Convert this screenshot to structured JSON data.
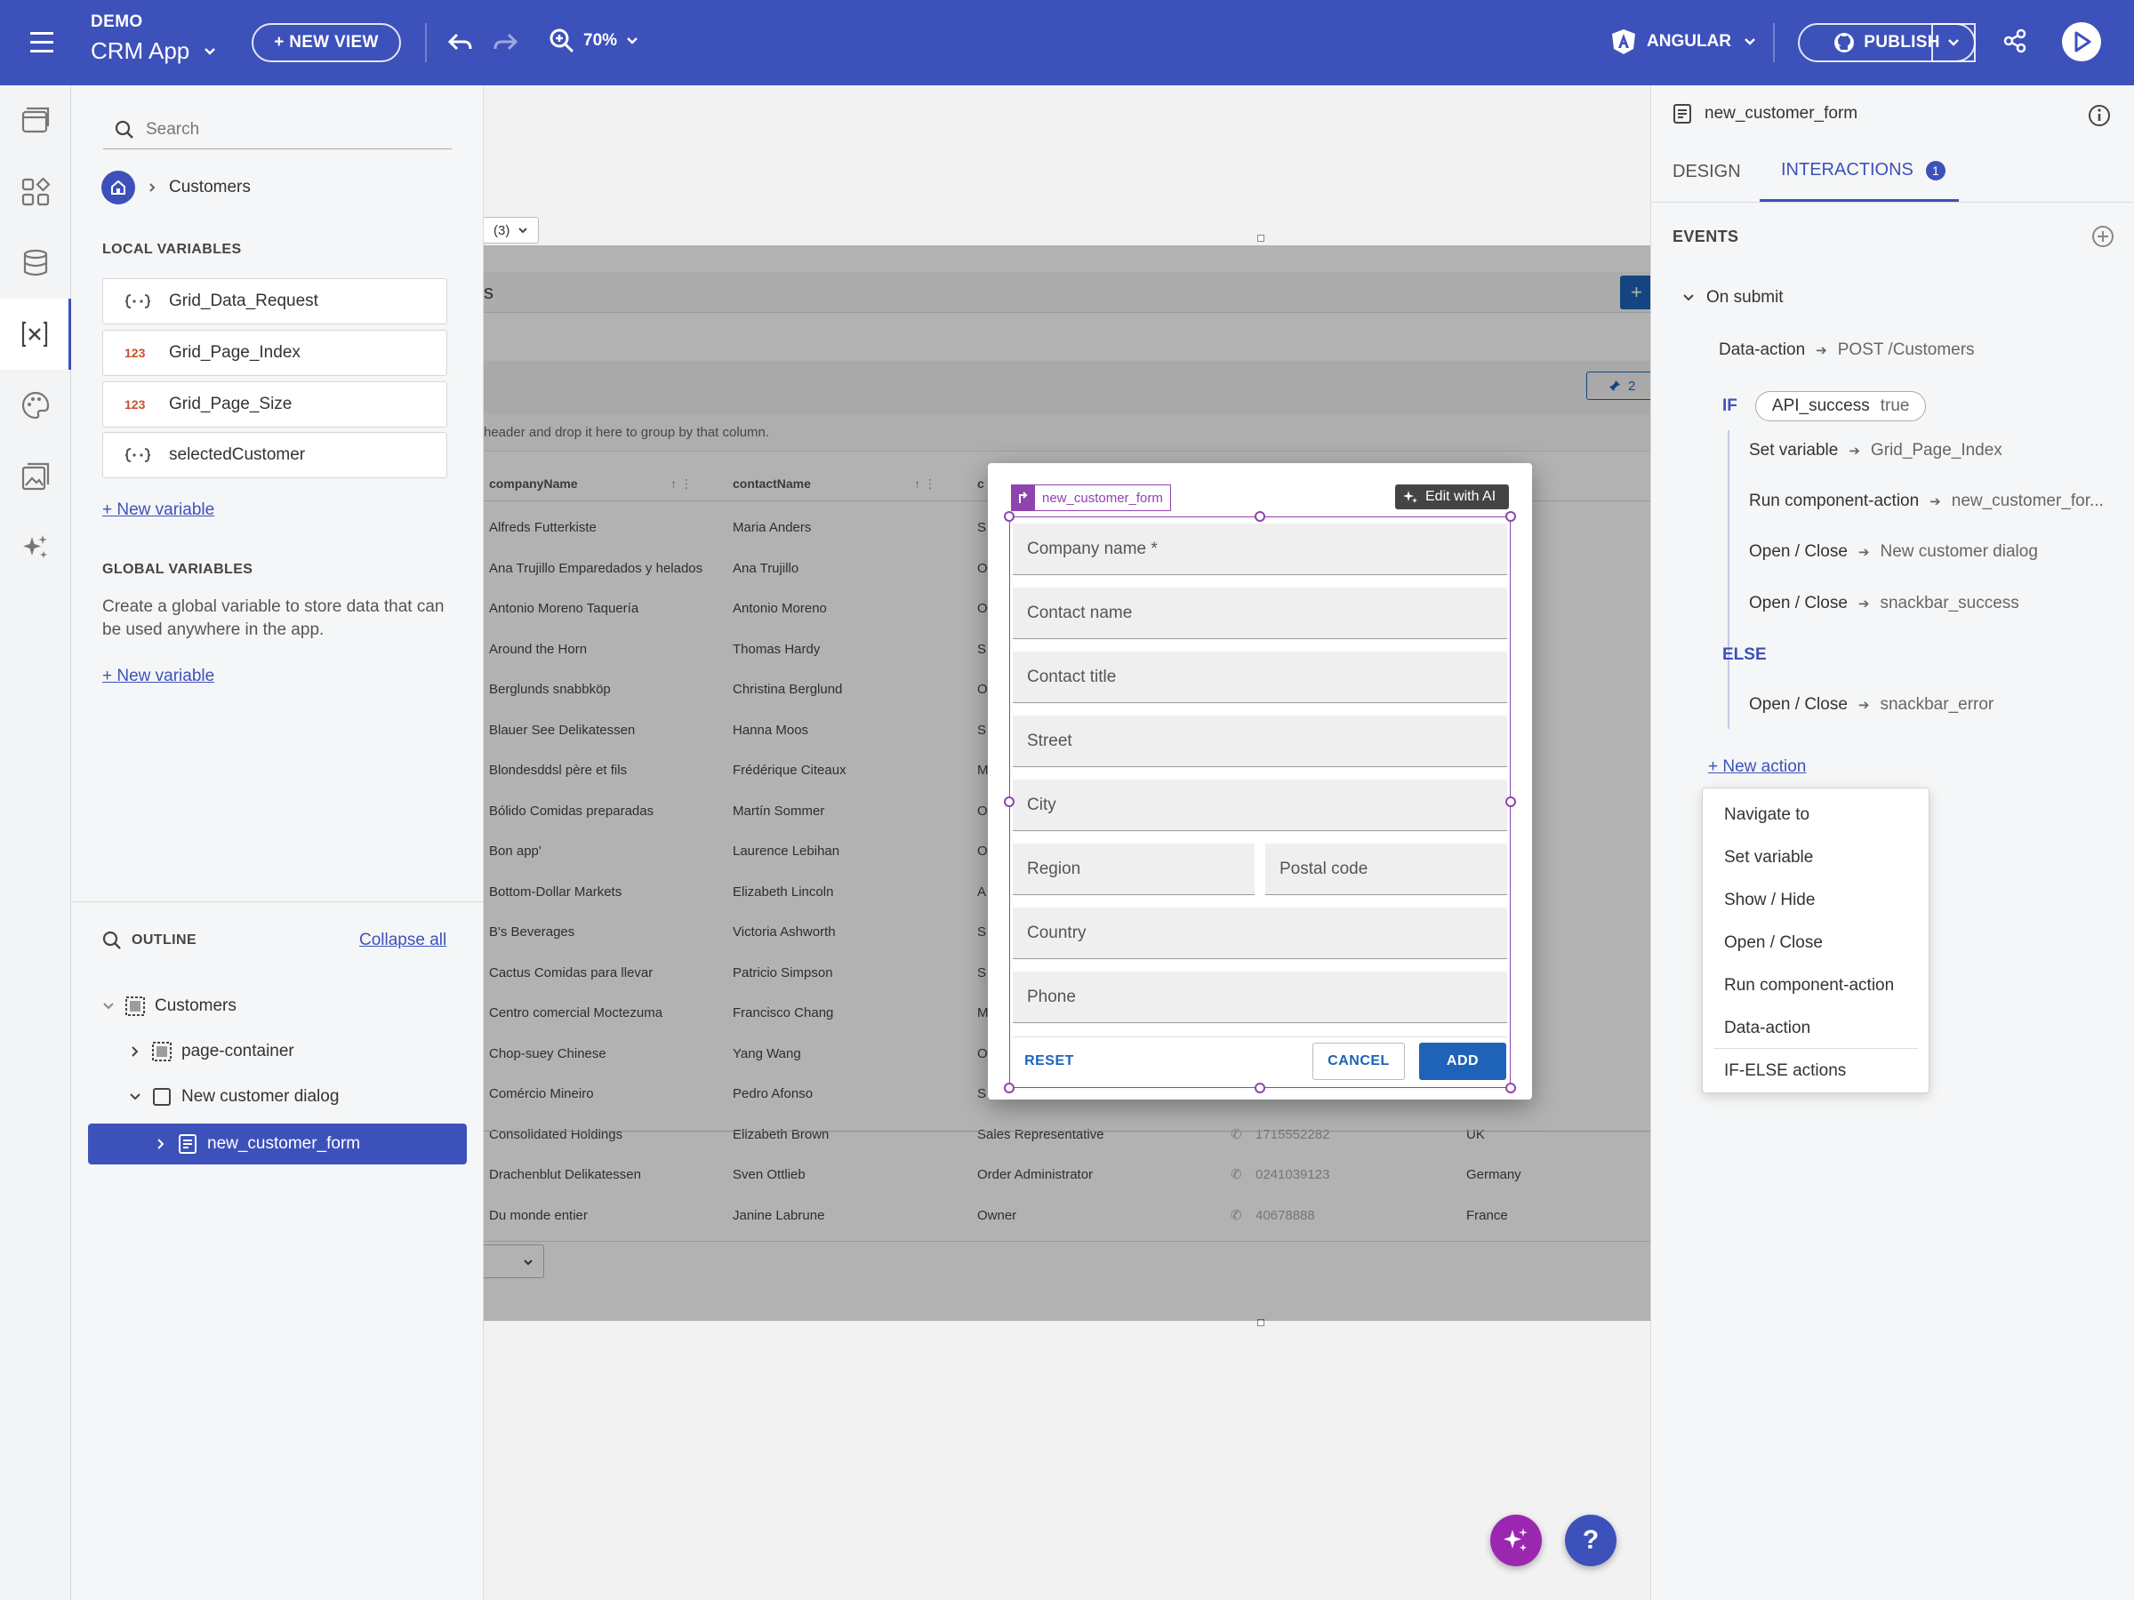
{
  "topbar": {
    "app_label": "DEMO",
    "app_name": "CRM App",
    "new_view": "+ NEW VIEW",
    "zoom": "70%",
    "framework": "ANGULAR",
    "publish": "PUBLISH"
  },
  "left_panel": {
    "search_placeholder": "Search",
    "breadcrumb": "Customers",
    "local_vars_title": "LOCAL VARIABLES",
    "local_vars": [
      {
        "icon": "{..}",
        "name": "Grid_Data_Request"
      },
      {
        "icon": "123",
        "name": "Grid_Page_Index"
      },
      {
        "icon": "123",
        "name": "Grid_Page_Size"
      },
      {
        "icon": "{..}",
        "name": "selectedCustomer"
      }
    ],
    "new_variable": "+ New variable",
    "global_vars_title": "GLOBAL VARIABLES",
    "global_desc": "Create a global variable to store data that can be used anywhere in the app.",
    "global_new_variable": "+ New variable",
    "outline_title": "OUTLINE",
    "collapse_all": "Collapse all",
    "outline": [
      {
        "label": "Customers"
      },
      {
        "label": "page-container"
      },
      {
        "label": "New customer dialog"
      },
      {
        "label": "new_customer_form"
      }
    ]
  },
  "canvas": {
    "dropdown_value": "(3)",
    "partial_title": "s",
    "group_hint": "header and drop it here to group by that column.",
    "pinned_count": "2",
    "col_company": "companyName",
    "col_contact": "contactName",
    "col_title_partial": "c",
    "rows": [
      {
        "company": "Alfreds Futterkiste",
        "contact": "Maria Anders",
        "title": "S"
      },
      {
        "company": "Ana Trujillo Emparedados y helados",
        "contact": "Ana Trujillo",
        "title": "O"
      },
      {
        "company": "Antonio Moreno Taquería",
        "contact": "Antonio Moreno",
        "title": "O"
      },
      {
        "company": "Around the Horn",
        "contact": "Thomas Hardy",
        "title": "S"
      },
      {
        "company": "Berglunds snabbköp",
        "contact": "Christina Berglund",
        "title": "O"
      },
      {
        "company": "Blauer See Delikatessen",
        "contact": "Hanna Moos",
        "title": "S"
      },
      {
        "company": "Blondesddsl père et fils",
        "contact": "Frédérique Citeaux",
        "title": "M"
      },
      {
        "company": "Bólido Comidas preparadas",
        "contact": "Martín Sommer",
        "title": "O"
      },
      {
        "company": "Bon app'",
        "contact": "Laurence Lebihan",
        "title": "O"
      },
      {
        "company": "Bottom-Dollar Markets",
        "contact": "Elizabeth Lincoln",
        "title": "A"
      },
      {
        "company": "B's Beverages",
        "contact": "Victoria Ashworth",
        "title": "S"
      },
      {
        "company": "Cactus Comidas para llevar",
        "contact": "Patricio Simpson",
        "title": "S"
      },
      {
        "company": "Centro comercial Moctezuma",
        "contact": "Francisco Chang",
        "title": "M"
      },
      {
        "company": "Chop-suey Chinese",
        "contact": "Yang Wang",
        "title": "O"
      },
      {
        "company": "Comércio Mineiro",
        "contact": "Pedro Afonso",
        "title": "S"
      },
      {
        "company": "Consolidated Holdings",
        "contact": "Elizabeth Brown",
        "title": "Sales Representative",
        "phone": "1715552282",
        "country": "UK"
      },
      {
        "company": "Drachenblut Delikatessen",
        "contact": "Sven Ottlieb",
        "title": "Order Administrator",
        "phone": "0241039123",
        "country": "Germany"
      },
      {
        "company": "Du monde entier",
        "contact": "Janine Labrune",
        "title": "Owner",
        "phone": "40678888",
        "country": "France"
      }
    ]
  },
  "dialog": {
    "form_tag": "new_customer_form",
    "edit_ai": "Edit with AI",
    "fields": {
      "company": "Company name *",
      "contact": "Contact name",
      "title": "Contact title",
      "street": "Street",
      "city": "City",
      "region": "Region",
      "postal": "Postal code",
      "country": "Country",
      "phone": "Phone"
    },
    "reset": "RESET",
    "cancel": "CANCEL",
    "add": "ADD"
  },
  "right_panel": {
    "component": "new_customer_form",
    "tab_design": "DESIGN",
    "tab_interactions": "INTERACTIONS",
    "interactions_count": "1",
    "events_title": "EVENTS",
    "event": "On submit",
    "data_action": "Data-action",
    "data_action_target": "POST /Customers",
    "if": "IF",
    "condition_var": "API_success",
    "condition_val": "true",
    "if_actions": [
      {
        "action": "Set variable",
        "target": "Grid_Page_Index"
      },
      {
        "action": "Run component-action",
        "target": "new_customer_for..."
      },
      {
        "action": "Open / Close",
        "target": "New customer dialog"
      },
      {
        "action": "Open / Close",
        "target": "snackbar_success"
      }
    ],
    "else": "ELSE",
    "else_actions": [
      {
        "action": "Open / Close",
        "target": "snackbar_error"
      }
    ],
    "new_action": "+ New action",
    "menu": [
      "Navigate to",
      "Set variable",
      "Show / Hide",
      "Open / Close",
      "Run component-action",
      "Data-action",
      "IF-ELSE actions"
    ]
  },
  "colors": {
    "brand": "#3d51bb",
    "accent_purple": "#8e44ad",
    "primary_button": "#1f63b8"
  }
}
